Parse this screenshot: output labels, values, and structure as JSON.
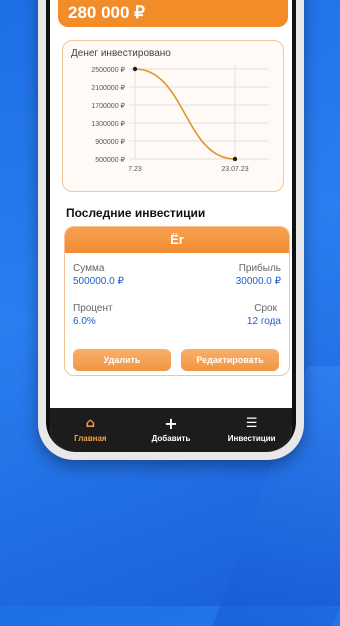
{
  "header": {
    "total_value": "280 000 ₽"
  },
  "chart_card": {
    "title": "Денег инвестировано"
  },
  "chart_data": {
    "type": "line",
    "title": "Денег инвестировано",
    "x": [
      "7.23",
      "23.07.23"
    ],
    "y_ticks": [
      "2500000 ₽",
      "2100000 ₽",
      "1700000 ₽",
      "1300000 ₽",
      "900000 ₽",
      "500000 ₽"
    ],
    "series": [
      {
        "values": [
          2500000,
          500000
        ]
      }
    ],
    "ylim": [
      500000,
      2500000
    ],
    "grid": true,
    "colors": {
      "line": "#e0952e",
      "point": "#222222"
    }
  },
  "section": {
    "title": "Последние инвестиции"
  },
  "investment": {
    "name": "Ёr",
    "sum_label": "Сумма",
    "sum_value": "500000.0 ₽",
    "profit_label": "Прибыль",
    "profit_value": "30000.0 ₽",
    "percent_label": "Процент",
    "percent_value": "6.0%",
    "term_label": "Срок",
    "term_value": "12 года",
    "delete_label": "Удалить",
    "edit_label": "Редактировать"
  },
  "nav": {
    "items": [
      {
        "icon": "home-icon",
        "glyph": "⌂",
        "label": "Главная"
      },
      {
        "icon": "plus-icon",
        "glyph": "+",
        "label": "Добавить"
      },
      {
        "icon": "list-icon",
        "glyph": "☰",
        "label": "Инвестиции"
      }
    ]
  },
  "colors": {
    "accent": "#f28c28",
    "value": "#1f5fc8",
    "background": "#1e6fe6"
  }
}
